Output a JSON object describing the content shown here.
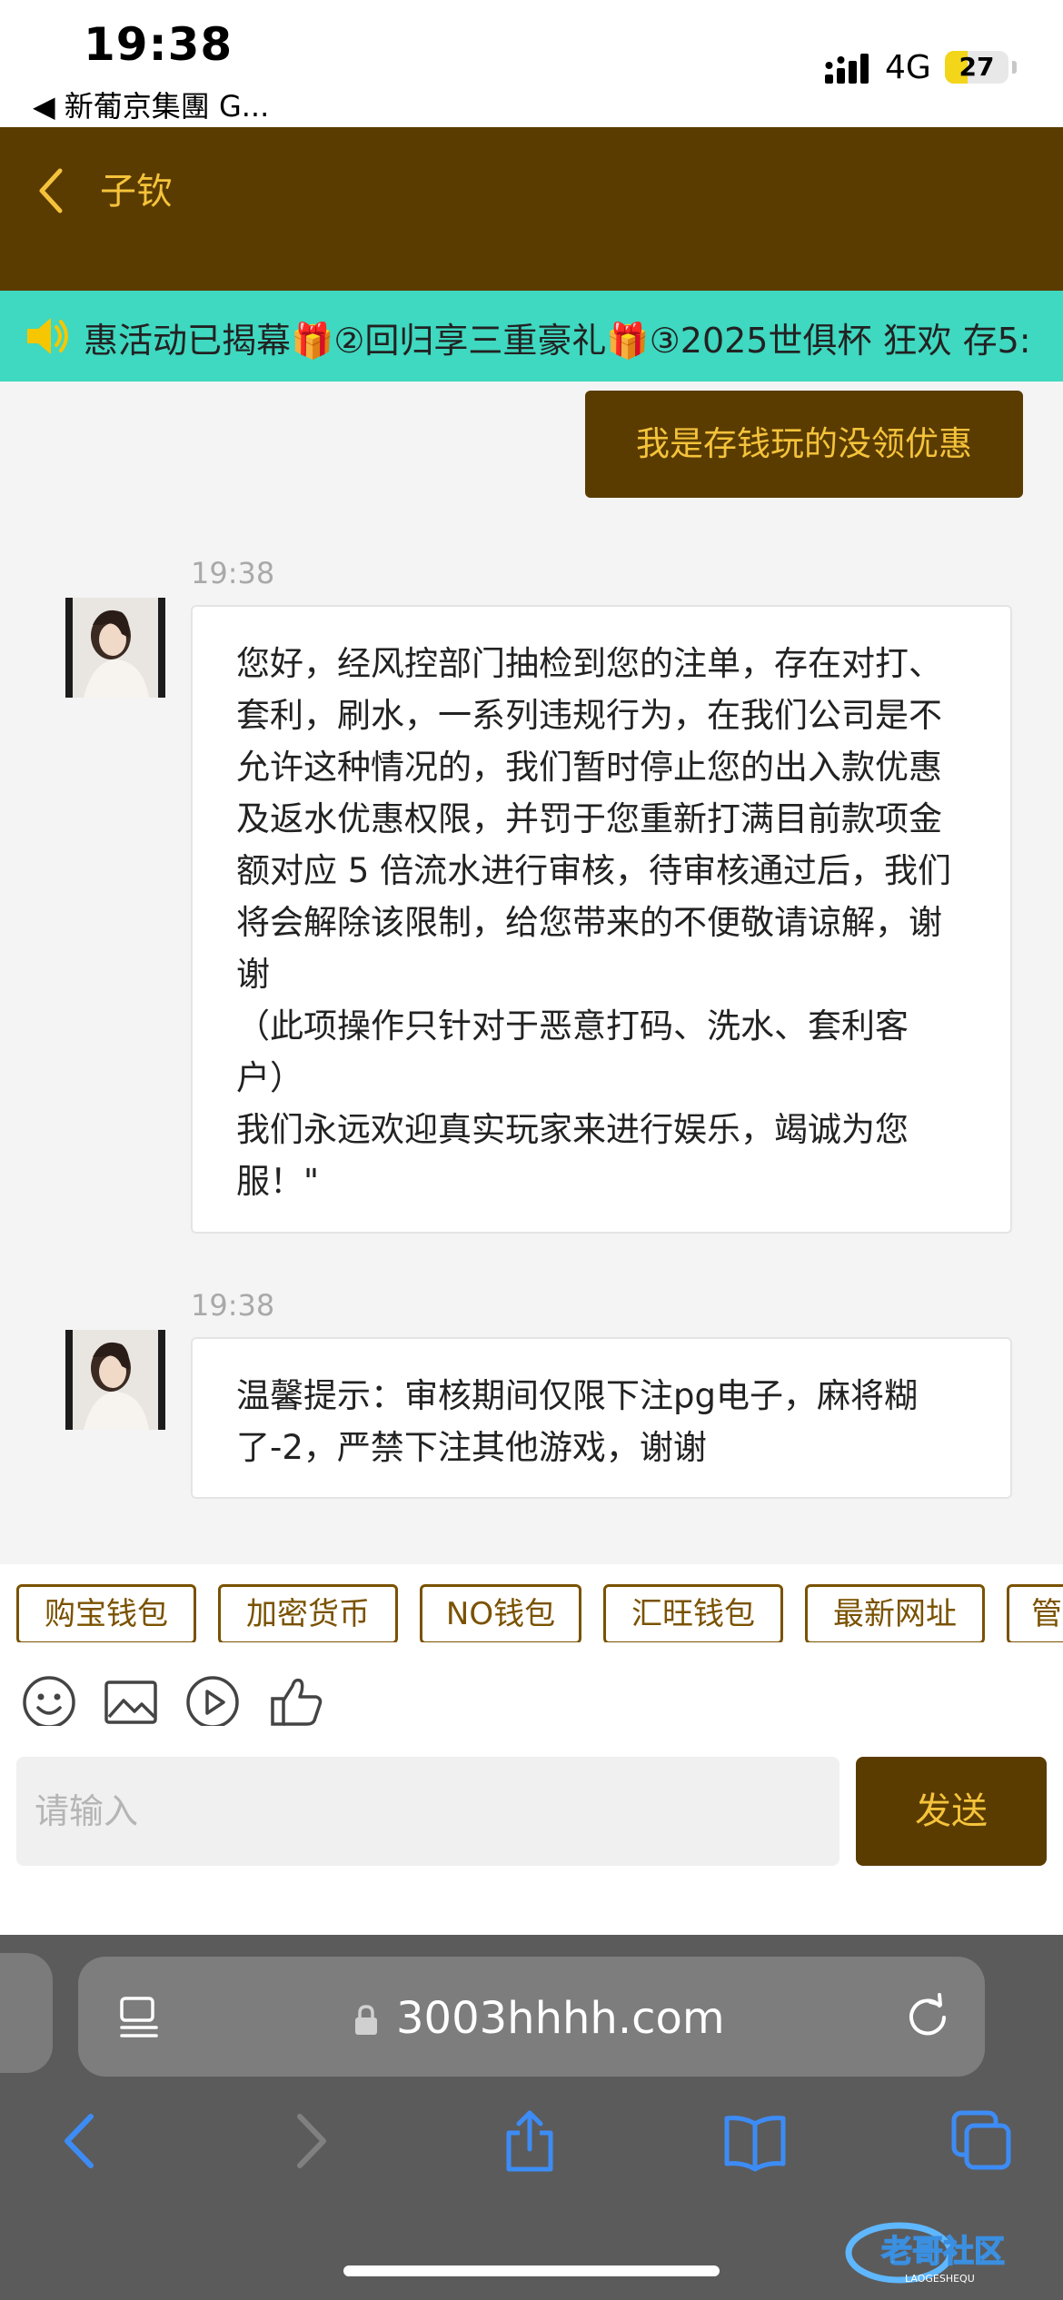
{
  "status_bar": {
    "time": "19:38",
    "back_app": "◀ 新葡京集團 G...",
    "network": "4G",
    "battery": "27",
    "battery_level": 0.27
  },
  "header": {
    "title": "子钦",
    "accent_color": "#f5c33b",
    "bg_color": "#5a3c00"
  },
  "marquee": {
    "text": "惠活动已揭幕🎁②回归享三重豪礼🎁③2025世俱杯 狂欢 存5:"
  },
  "messages": {
    "outgoing": "我是存钱玩的没领优惠",
    "items": [
      {
        "time": "19:38",
        "text": "您好，经风控部门抽检到您的注单，存在对打、套利，刷水，一系列违规行为，在我们公司是不允许这种情况的，我们暂时停止您的出入款优惠及返水优惠权限，并罚于您重新打满目前款项金额对应 5 倍流水进行审核，待审核通过后，我们将会解除该限制，给您带来的不便敬请谅解，谢谢\n（此项操作只针对于恶意打码、洗水、套利客户）\n我们永远欢迎真实玩家来进行娱乐，竭诚为您服！\""
      },
      {
        "time": "19:38",
        "text": "温馨提示：审核期间仅限下注pg电子，麻将糊了-2，严禁下注其他游戏，谢谢"
      }
    ]
  },
  "quick_tags": [
    "购宝钱包",
    "加密货币",
    "NO钱包",
    "汇旺钱包",
    "最新网址",
    "管"
  ],
  "toolbar_icons": [
    "emoji-icon",
    "image-icon",
    "video-icon",
    "thumbs-up-icon"
  ],
  "input": {
    "placeholder": "请输入",
    "send_label": "发送"
  },
  "browser": {
    "url": "3003hhhh.com"
  },
  "watermark": {
    "text": "老哥社区"
  }
}
